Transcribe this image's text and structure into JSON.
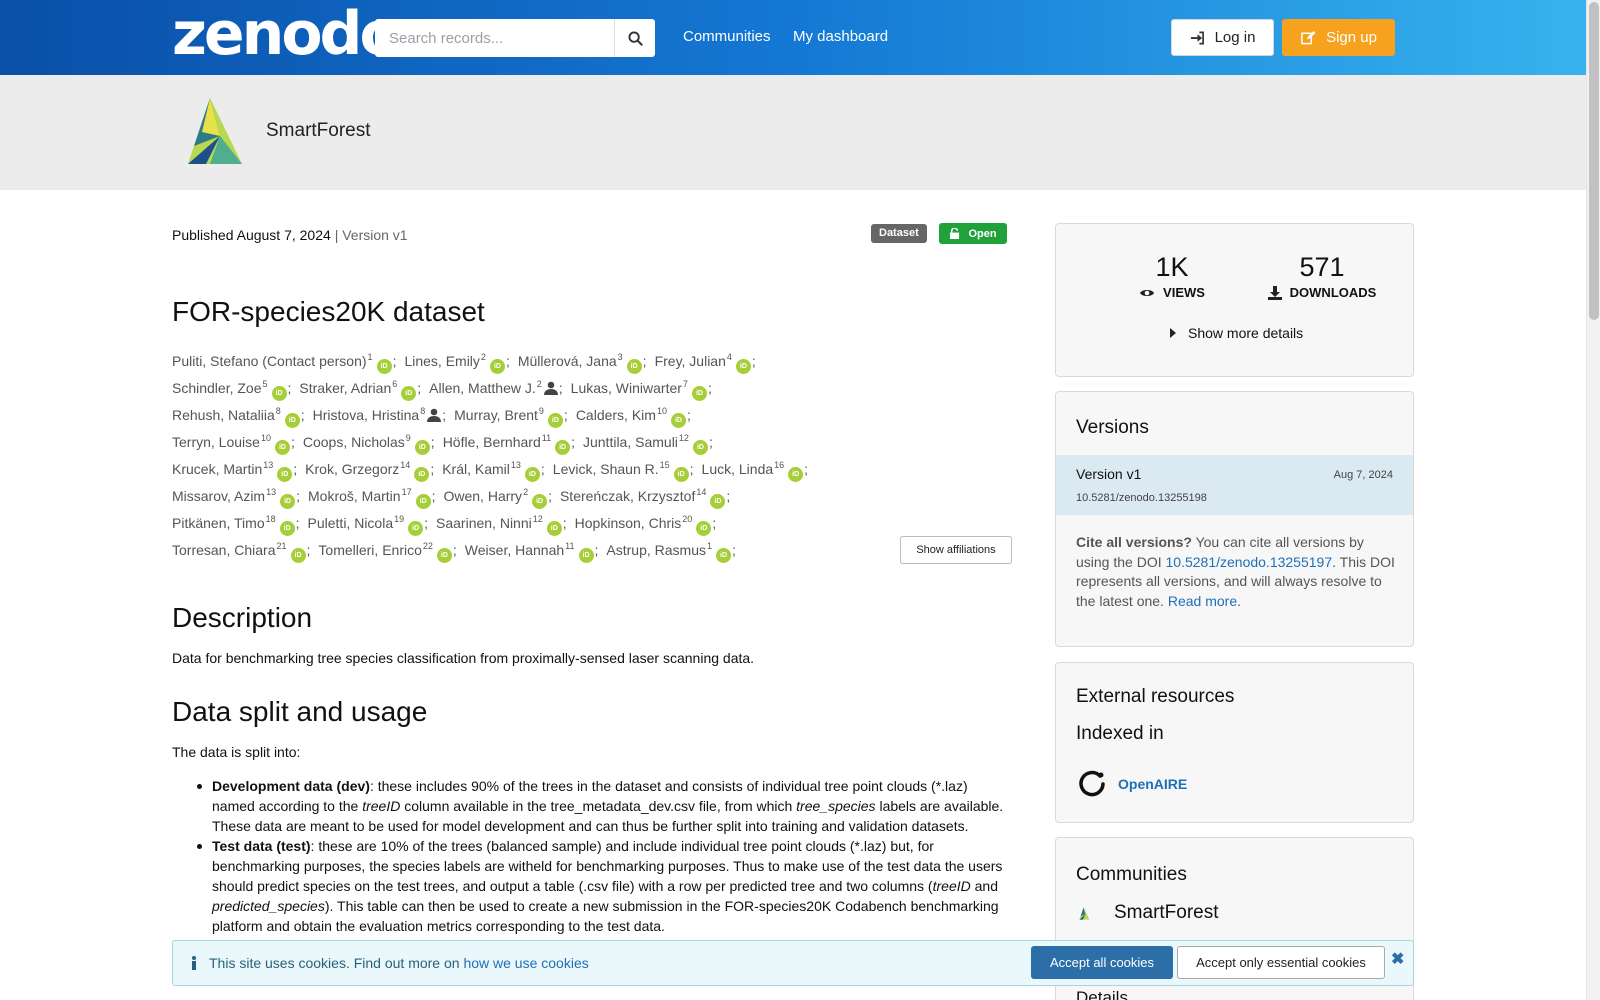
{
  "header": {
    "logo": "zenodo",
    "search_placeholder": "Search records...",
    "nav": [
      "Communities",
      "My dashboard"
    ],
    "login_label": "Log in",
    "signup_label": "Sign up"
  },
  "community": {
    "name": "SmartForest"
  },
  "record": {
    "published": "Published August 7, 2024",
    "version": "| Version v1",
    "badge_type": "Dataset",
    "badge_access": "Open",
    "title": "FOR-species20K dataset",
    "show_affiliations": "Show affiliations"
  },
  "creators": [
    [
      {
        "name": "Puliti, Stefano (Contact person)",
        "sup": "1",
        "icon": "orcid"
      },
      {
        "name": "Lines, Emily",
        "sup": "2",
        "icon": "orcid"
      },
      {
        "name": "Müllerová, Jana",
        "sup": "3",
        "icon": "orcid"
      },
      {
        "name": "Frey, Julian",
        "sup": "4",
        "icon": "orcid"
      }
    ],
    [
      {
        "name": "Schindler, Zoe",
        "sup": "5",
        "icon": "orcid"
      },
      {
        "name": "Straker, Adrian",
        "sup": "6",
        "icon": "orcid"
      },
      {
        "name": "Allen, Matthew J.",
        "sup": "2",
        "icon": "person"
      },
      {
        "name": "Lukas, Winiwarter",
        "sup": "7",
        "icon": "orcid"
      }
    ],
    [
      {
        "name": "Rehush, Nataliia",
        "sup": "8",
        "icon": "orcid"
      },
      {
        "name": "Hristova, Hristina",
        "sup": "8",
        "icon": "person"
      },
      {
        "name": "Murray, Brent",
        "sup": "9",
        "icon": "orcid"
      },
      {
        "name": "Calders, Kim",
        "sup": "10",
        "icon": "orcid"
      }
    ],
    [
      {
        "name": "Terryn, Louise",
        "sup": "10",
        "icon": "orcid"
      },
      {
        "name": "Coops, Nicholas",
        "sup": "9",
        "icon": "orcid"
      },
      {
        "name": "Höfle, Bernhard",
        "sup": "11",
        "icon": "orcid"
      },
      {
        "name": "Junttila, Samuli",
        "sup": "12",
        "icon": "orcid"
      }
    ],
    [
      {
        "name": "Krucek, Martin",
        "sup": "13",
        "icon": "orcid"
      },
      {
        "name": "Krok, Grzegorz",
        "sup": "14",
        "icon": "orcid"
      },
      {
        "name": "Král, Kamil",
        "sup": "13",
        "icon": "orcid"
      },
      {
        "name": "Levick, Shaun R.",
        "sup": "15",
        "icon": "orcid"
      },
      {
        "name": "Luck, Linda",
        "sup": "16",
        "icon": "orcid"
      }
    ],
    [
      {
        "name": "Missarov, Azim",
        "sup": "13",
        "icon": "orcid"
      },
      {
        "name": "Mokroš, Martin",
        "sup": "17",
        "icon": "orcid"
      },
      {
        "name": "Owen, Harry",
        "sup": "2",
        "icon": "orcid"
      },
      {
        "name": "Stereńczak, Krzysztof",
        "sup": "14",
        "icon": "orcid"
      }
    ],
    [
      {
        "name": "Pitkänen, Timo",
        "sup": "18",
        "icon": "orcid"
      },
      {
        "name": "Puletti, Nicola",
        "sup": "19",
        "icon": "orcid"
      },
      {
        "name": "Saarinen, Ninni",
        "sup": "12",
        "icon": "orcid"
      },
      {
        "name": "Hopkinson, Chris",
        "sup": "20",
        "icon": "orcid"
      }
    ],
    [
      {
        "name": "Torresan, Chiara",
        "sup": "21",
        "icon": "orcid"
      },
      {
        "name": "Tomelleri, Enrico",
        "sup": "22",
        "icon": "orcid"
      },
      {
        "name": "Weiser, Hannah",
        "sup": "11",
        "icon": "orcid"
      },
      {
        "name": "Astrup, Rasmus",
        "sup": "1",
        "icon": "orcid"
      }
    ]
  ],
  "description": {
    "heading": "Description",
    "text": "Data for benchmarking tree species classification from proximally-sensed laser scanning data."
  },
  "data_split": {
    "heading": "Data split and usage",
    "intro": "The data is split into:",
    "dev_label": "Development data (dev)",
    "dev_text_1": ": these includes 90% of the trees in the dataset and consists of individual tree point clouds (*.laz) named according to the ",
    "dev_em_1": "treeID",
    "dev_text_2": " column available in the tree_metadata_dev.csv file, from which ",
    "dev_em_2": "tree_species",
    "dev_text_3": " labels are available. These data are meant to be used for model development and can thus be further split into training and validation datasets.",
    "test_label": "Test data (test)",
    "test_text_1": ": these are 10% of the trees (balanced sample) and include individual tree point clouds (*.laz) but, for benchmarking purposes, the species labels are witheld for benchmarking purposes. Thus to make use of the test data the users should predict species on the test trees, and output a table (.csv file) with a row per predicted tree and two columns (",
    "test_em_1": "treeID",
    "test_text_2": " and ",
    "test_em_2": "predicted_species",
    "test_text_3": "). This table can then be used to create a new submission in the FOR-species20K Codabench benchmarking platform and obtain the evaluation metrics corresponding to the test data."
  },
  "stats": {
    "views": "1K",
    "views_label": "VIEWS",
    "downloads": "571",
    "downloads_label": "DOWNLOADS",
    "more": "Show more details"
  },
  "versions": {
    "heading": "Versions",
    "current_label": "Version v1",
    "current_date": "Aug 7, 2024",
    "current_doi": "10.5281/zenodo.13255198",
    "cite_bold": "Cite all versions?",
    "cite_text_1": " You can cite all versions by using the DOI ",
    "cite_doi": "10.5281/zenodo.13255197",
    "cite_text_2": ". This DOI represents all versions, and will always resolve to the latest one. ",
    "read_more": "Read more",
    "cite_text_3": "."
  },
  "external": {
    "heading": "External resources",
    "indexed": "Indexed in",
    "source": "OpenAIRE"
  },
  "communities_card": {
    "heading": "Communities",
    "item": "SmartForest",
    "next_heading": "Details"
  },
  "cookie": {
    "text": "This site uses cookies. Find out more on ",
    "link": "how we use cookies",
    "accept_all": "Accept all cookies",
    "accept_essential": "Accept only essential cookies"
  },
  "colors": {
    "header_start": "#0a4fa8",
    "header_end": "#36b3ee",
    "signup": "#f6a21e",
    "open_badge": "#21a13a",
    "orcid": "#a6ce39"
  }
}
